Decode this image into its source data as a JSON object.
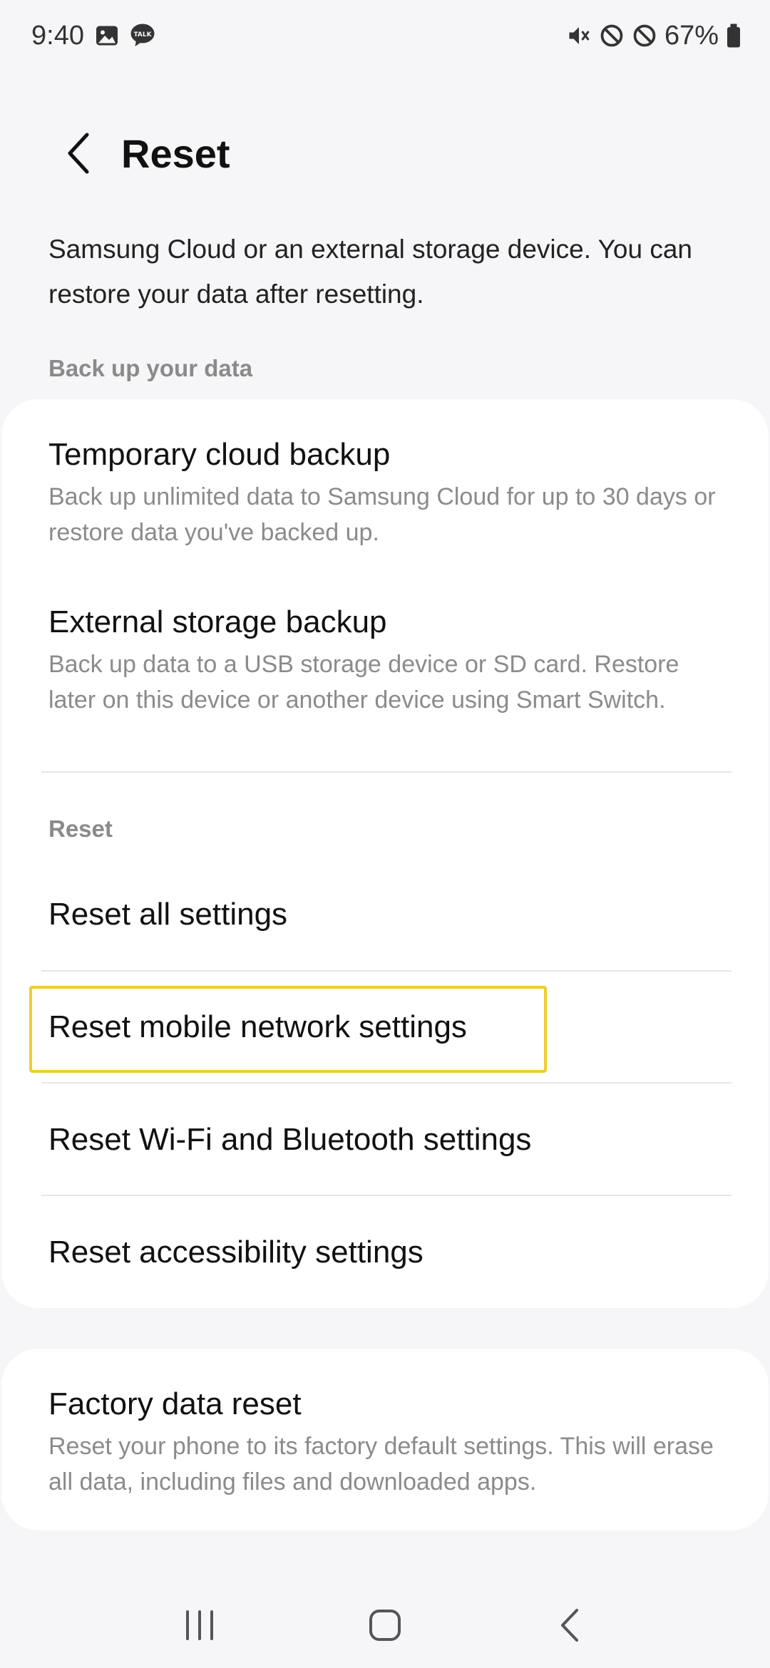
{
  "status_bar": {
    "time": "9:40",
    "battery": "67%"
  },
  "header": {
    "title": "Reset"
  },
  "intro": {
    "text": "Samsung Cloud or an external storage device. You can restore your data after resetting."
  },
  "sections": {
    "backup_label": "Back up your data",
    "reset_label": "Reset"
  },
  "backup_items": [
    {
      "title": "Temporary cloud backup",
      "desc": "Back up unlimited data to Samsung Cloud for up to 30 days or restore data you've backed up."
    },
    {
      "title": "External storage backup",
      "desc": "Back up data to a USB storage device or SD card. Restore later on this device or another device using Smart Switch."
    }
  ],
  "reset_items": [
    {
      "title": "Reset all settings"
    },
    {
      "title": "Reset mobile network settings"
    },
    {
      "title": "Reset Wi-Fi and Bluetooth settings"
    },
    {
      "title": "Reset accessibility settings"
    }
  ],
  "factory": {
    "title": "Factory data reset",
    "desc": "Reset your phone to its factory default settings. This will erase all data, including files and downloaded apps."
  },
  "colors": {
    "background": "#f6f6f8",
    "card": "#ffffff",
    "highlight": "#f0cd2e",
    "secondary_text": "#8b8b8b"
  }
}
